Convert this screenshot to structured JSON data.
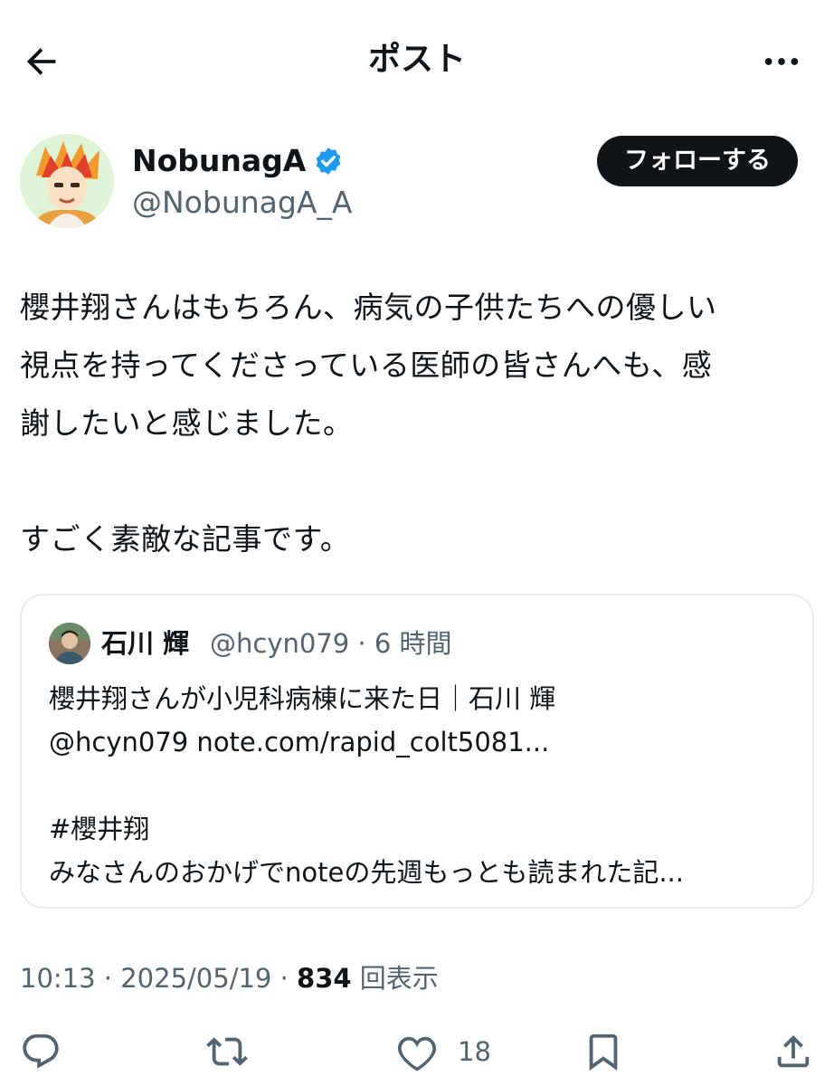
{
  "header": {
    "title": "ポスト",
    "back_icon": "arrow-left-icon",
    "more_icon": "more-horizontal-icon"
  },
  "author": {
    "name": "NobunagA",
    "handle": "@NobunagA_A",
    "verified": true,
    "follow_label": "フォローする"
  },
  "post": {
    "text": "櫻井翔さんはもちろん、病気の子供たちへの優しい\n視点を持ってくださっている医師の皆さんへも、感\n謝したいと感じました。\n\nすごく素敵な記事です。"
  },
  "quote": {
    "name": "石川 輝",
    "meta": "@hcyn079 · 6 時間",
    "text": "櫻井翔さんが小児科病棟に来た日｜石川 輝\n@hcyn079 note.com/rapid_colt5081...\n\n#櫻井翔\nみなさんのおかげでnoteの先週もっとも読まれた記..."
  },
  "meta": {
    "time": "10:13 · 2025/05/19 · ",
    "views_count": "834",
    "views_label": " 回表示"
  },
  "actions": {
    "reply_icon": "reply-icon",
    "repost_icon": "repost-icon",
    "like_icon": "heart-icon",
    "like_count": "18",
    "bookmark_icon": "bookmark-icon",
    "share_icon": "share-icon"
  },
  "colors": {
    "text": "#0f1419",
    "secondary": "#536471",
    "verified_blue": "#1d9bf0",
    "border": "#e6ecf0"
  }
}
